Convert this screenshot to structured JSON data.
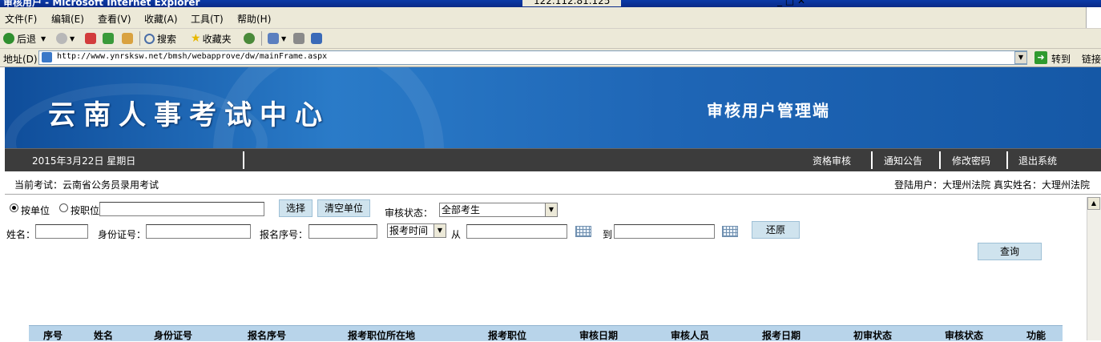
{
  "window": {
    "title": "审核用户 - Microsoft Internet Explorer",
    "ip": "122.112.81.125",
    "controls": "_ □ ✕"
  },
  "menu": [
    "文件(F)",
    "编辑(E)",
    "查看(V)",
    "收藏(A)",
    "工具(T)",
    "帮助(H)"
  ],
  "toolbar": {
    "back": "后退",
    "search": "搜索",
    "favorites": "收藏夹"
  },
  "address": {
    "label": "地址(D)",
    "url": "http://www.ynrsksw.net/bmsh/webapprove/dw/mainFrame.aspx",
    "go": "转到",
    "links": "链接"
  },
  "banner": {
    "title": "云南人事考试中心",
    "subtitle": "审核用户管理端"
  },
  "nav": {
    "date": "2015年3月22日 星期日",
    "links": [
      "资格审核",
      "通知公告",
      "修改密码",
      "退出系统"
    ]
  },
  "info": {
    "current_exam": "当前考试：云南省公务员录用考试",
    "login_user": "登陆用户：大理州法院 真实姓名：大理州法院"
  },
  "filter": {
    "by_unit": "按单位",
    "by_position": "按职位",
    "by_unit_selected": true,
    "select_btn": "选择",
    "clear_unit_btn": "清空单位",
    "status_label": "审核状态：",
    "status_value": "全部考生",
    "name_label": "姓名：",
    "idcard_label": "身份证号：",
    "regno_label": "报名序号：",
    "time_value": "报考时间",
    "from_label": "从",
    "to_label": "到",
    "reset_btn": "还原",
    "query_btn": "查询"
  },
  "table": {
    "columns": [
      "序号",
      "姓名",
      "身份证号",
      "报名序号",
      "报考职位所在地",
      "报考职位",
      "审核日期",
      "审核人员",
      "报考日期",
      "初审状态",
      "审核状态",
      "功能"
    ]
  },
  "colors": {
    "banner": "#1f66b6",
    "nav_strip": "#3c3c3c",
    "table_header": "#b8d4ea",
    "button": "#cfe3ee"
  }
}
